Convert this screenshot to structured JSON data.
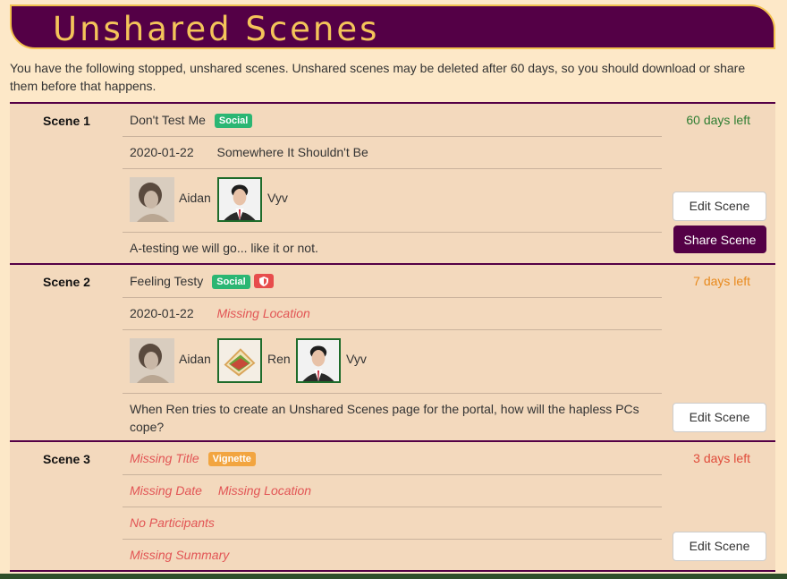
{
  "header": {
    "title": "Unshared Scenes"
  },
  "intro": "You have the following stopped, unshared scenes. Unshared scenes may be deleted after 60 days, so you should download or share them before that happens.",
  "colors": {
    "banner": "#540046",
    "banner_border": "#f2c14e",
    "title": "#f4c45a",
    "missing": "#e25555"
  },
  "buttons": {
    "edit": "Edit Scene",
    "share": "Share Scene"
  },
  "scenes": [
    {
      "label": "Scene 1",
      "title": "Don't Test Me",
      "tag": "Social",
      "date": "2020-01-22",
      "location": "Somewhere It Shouldn't Be",
      "participants": [
        "Aidan",
        "Vyv"
      ],
      "summary": "A-testing we will go... like it or not.",
      "days_left": "60 days left",
      "days_color": "#2e7d32"
    },
    {
      "label": "Scene 2",
      "title": "Feeling Testy",
      "tag": "Social",
      "date": "2020-01-22",
      "location": "Missing Location",
      "participants": [
        "Aidan",
        "Ren",
        "Vyv"
      ],
      "summary": "When Ren tries to create an Unshared Scenes page for the portal, how will the hapless PCs cope?",
      "days_left": "7 days left",
      "days_color": "#e8891c"
    },
    {
      "label": "Scene 3",
      "title": "Missing Title",
      "tag": "Vignette",
      "date": "Missing Date",
      "location": "Missing Location",
      "participants_text": "No Participants",
      "summary": "Missing Summary",
      "days_left": "3 days left",
      "days_color": "#e04b3a"
    }
  ]
}
